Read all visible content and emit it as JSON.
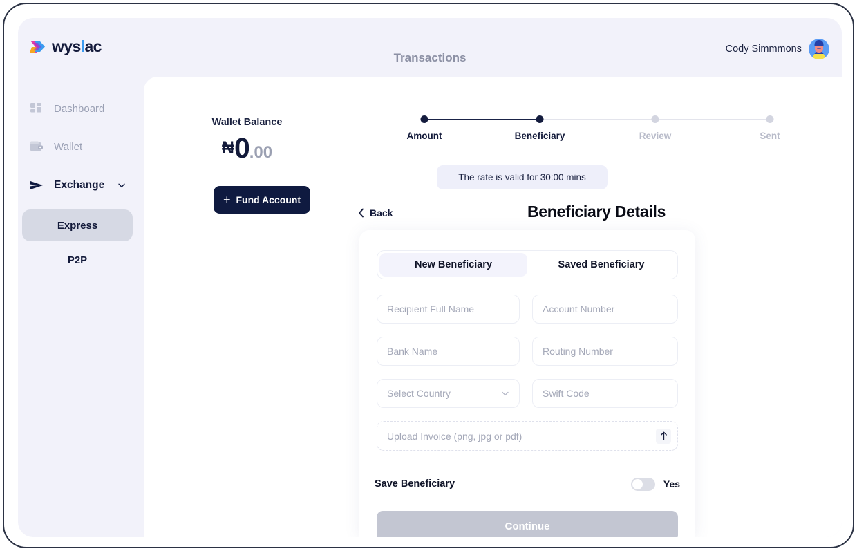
{
  "brand": {
    "logo_text_main": "wys",
    "logo_text_accent": "l",
    "logo_text_tail": "ac",
    "logo_icon": "wyslac-chevron-logo",
    "colors": {
      "navy": "#0f1a40",
      "page_bg": "#f2f2fa",
      "accent_lavender": "#eeeffa",
      "muted_text": "#9aa0b4",
      "disabled_button": "#c3c6d2"
    }
  },
  "header": {
    "title": "Transactions",
    "user_name": "Cody Simmmons",
    "avatar_icon": "user-avatar"
  },
  "sidebar": {
    "items": [
      {
        "label": "Dashboard",
        "icon": "dashboard-grid-icon",
        "state": "inactive"
      },
      {
        "label": "Wallet",
        "icon": "wallet-icon",
        "state": "inactive"
      },
      {
        "label": "Exchange",
        "icon": "send-arrow-icon",
        "state": "expanded",
        "chevron": "chevron-down-icon"
      },
      {
        "label": "Express",
        "icon": "",
        "state": "selected"
      },
      {
        "label": "P2P",
        "icon": "",
        "state": "inactive"
      }
    ]
  },
  "wallet": {
    "label": "Wallet Balance",
    "currency_symbol": "₦",
    "amount_integer": "0",
    "amount_decimal": ".00",
    "fund_button_label": "Fund Account",
    "fund_button_icon": "plus-icon"
  },
  "stepper": {
    "steps": [
      {
        "label": "Amount",
        "state": "done"
      },
      {
        "label": "Beneficiary",
        "state": "done"
      },
      {
        "label": "Review",
        "state": "todo"
      },
      {
        "label": "Sent",
        "state": "todo"
      }
    ]
  },
  "flow": {
    "rate_notice": "The rate is valid for 30:00 mins",
    "back_label": "Back",
    "back_icon": "chevron-left-icon",
    "section_title": "Beneficiary Details"
  },
  "form": {
    "tabs": [
      {
        "label": "New Beneficiary",
        "active": true
      },
      {
        "label": "Saved Beneficiary",
        "active": false
      }
    ],
    "fields": [
      {
        "name": "recipient-full-name",
        "placeholder": "Recipient Full Name",
        "type": "text"
      },
      {
        "name": "account-number",
        "placeholder": "Account Number",
        "type": "text"
      },
      {
        "name": "bank-name",
        "placeholder": "Bank Name",
        "type": "text"
      },
      {
        "name": "routing-number",
        "placeholder": "Routing Number",
        "type": "text"
      },
      {
        "name": "select-country",
        "placeholder": "Select Country",
        "type": "select"
      },
      {
        "name": "swift-code",
        "placeholder": "Swift Code",
        "type": "text"
      }
    ],
    "upload": {
      "placeholder": "Upload Invoice (png, jpg or pdf)",
      "icon": "upload-arrow-icon"
    },
    "save_beneficiary": {
      "label": "Save Beneficiary",
      "toggle_state": "off",
      "value_label": "Yes"
    },
    "submit": {
      "label": "Continue",
      "enabled": false
    }
  }
}
